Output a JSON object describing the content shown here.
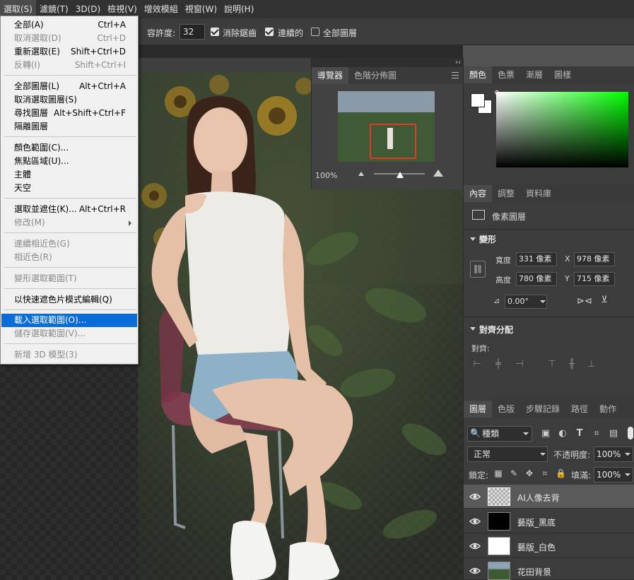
{
  "menubar": {
    "items": [
      "選取(S)",
      "濾鏡(T)",
      "3D(D)",
      "檢視(V)",
      "增效模組",
      "視窗(W)",
      "說明(H)"
    ]
  },
  "options_bar": {
    "tolerance_label": "容許度:",
    "tolerance_value": "32",
    "antialias_label": "消除鋸齒",
    "antialias_checked": true,
    "contiguous_label": "連續的",
    "contiguous_checked": true,
    "all_layers_label": "全部圖層",
    "all_layers_checked": false
  },
  "select_menu": {
    "items": [
      {
        "label": "全部(A)",
        "shortcut": "Ctrl+A",
        "disabled": false
      },
      {
        "label": "取消選取(D)",
        "shortcut": "Ctrl+D",
        "disabled": true
      },
      {
        "label": "重新選取(E)",
        "shortcut": "Shift+Ctrl+D",
        "disabled": false
      },
      {
        "label": "反轉(I)",
        "shortcut": "Shift+Ctrl+I",
        "disabled": true
      },
      {
        "label": "全部圖層(L)",
        "shortcut": "Alt+Ctrl+A",
        "disabled": false
      },
      {
        "label": "取消選取圖層(S)",
        "shortcut": "",
        "disabled": false
      },
      {
        "label": "尋找圖層",
        "shortcut": "Alt+Shift+Ctrl+F",
        "disabled": false
      },
      {
        "label": "隔離圖層",
        "shortcut": "",
        "disabled": false
      },
      {
        "label": "顏色範圍(C)...",
        "shortcut": "",
        "disabled": false
      },
      {
        "label": "焦點區域(U)...",
        "shortcut": "",
        "disabled": false
      },
      {
        "label": "主體",
        "shortcut": "",
        "disabled": false
      },
      {
        "label": "天空",
        "shortcut": "",
        "disabled": false
      },
      {
        "label": "選取並遮住(K)...",
        "shortcut": "Alt+Ctrl+R",
        "disabled": false
      },
      {
        "label": "修改(M)",
        "shortcut": "",
        "disabled": true
      },
      {
        "label": "連續相近色(G)",
        "shortcut": "",
        "disabled": true
      },
      {
        "label": "相近色(R)",
        "shortcut": "",
        "disabled": true
      },
      {
        "label": "變形選取範圍(T)",
        "shortcut": "",
        "disabled": true
      },
      {
        "label": "以快速遮色片模式編輯(Q)",
        "shortcut": "",
        "disabled": false
      },
      {
        "label": "載入選取範圍(O)...",
        "shortcut": "",
        "disabled": false,
        "highlighted": true
      },
      {
        "label": "儲存選取範圍(V)...",
        "shortcut": "",
        "disabled": true
      },
      {
        "label": "新增 3D 模型(3)",
        "shortcut": "",
        "disabled": true
      }
    ]
  },
  "navigator": {
    "tabs": [
      "導覽器",
      "色階分佈圖"
    ],
    "zoom": "100%"
  },
  "color_panel": {
    "tabs": [
      "顏色",
      "色票",
      "漸層",
      "圖樣"
    ],
    "hue_color": "#00ff00"
  },
  "properties": {
    "tabs": [
      "內容",
      "調整",
      "資料庫"
    ],
    "layer_type": "像素圖層",
    "transform_title": "變形",
    "width_label": "寬度",
    "width_value": "331 像素",
    "height_label": "高度",
    "height_value": "780 像素",
    "x_label": "X",
    "x_value": "978 像素",
    "y_label": "Y",
    "y_value": "715 像素",
    "angle_value": "0.00°",
    "align_title": "對齊分配",
    "align_label": "對齊:"
  },
  "layers": {
    "tabs": [
      "圖層",
      "色版",
      "步驟記錄",
      "路徑",
      "動作"
    ],
    "filter_kind": "種類",
    "blend_mode": "正常",
    "opacity_label": "不透明度:",
    "opacity_value": "100%",
    "lock_label": "鎖定:",
    "fill_label": "填滿:",
    "fill_value": "100%",
    "items": [
      {
        "name": "AI人像去背",
        "selected": true
      },
      {
        "name": "藝版_黑底",
        "selected": false
      },
      {
        "name": "藝版_白色",
        "selected": false
      },
      {
        "name": "花田背景",
        "selected": false
      }
    ]
  }
}
